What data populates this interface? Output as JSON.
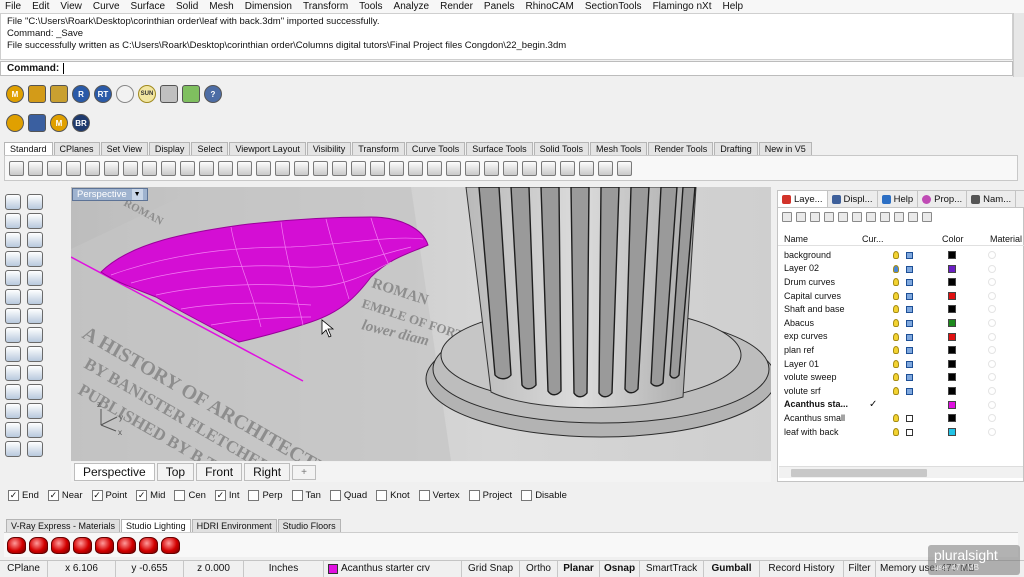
{
  "menu": [
    "File",
    "Edit",
    "View",
    "Curve",
    "Surface",
    "Solid",
    "Mesh",
    "Dimension",
    "Transform",
    "Tools",
    "Analyze",
    "Render",
    "Panels",
    "RhinoCAM",
    "SectionTools",
    "Flamingo nXt",
    "Help"
  ],
  "command_history": [
    "File \"C:\\Users\\Roark\\Desktop\\corinthian order\\leaf with back.3dm\" imported successfully.",
    "Command: _Save",
    "File successfully written as C:\\Users\\Roark\\Desktop\\corinthian order\\Columns digital tutors\\Final Project files Congdon\\22_begin.3dm"
  ],
  "command_prompt": "Command:",
  "plugin_row1": [
    "M",
    "",
    "",
    "R",
    "RT",
    "",
    "SUN",
    "",
    "",
    "?"
  ],
  "plugin_row2": [
    "",
    "",
    "M",
    "BR"
  ],
  "toolbar_tabs": [
    "Standard",
    "CPlanes",
    "Set View",
    "Display",
    "Select",
    "Viewport Layout",
    "Visibility",
    "Transform",
    "Curve Tools",
    "Surface Tools",
    "Solid Tools",
    "Mesh Tools",
    "Render Tools",
    "Drafting",
    "New in V5"
  ],
  "viewport": {
    "title": "Perspective",
    "tabs": [
      "Perspective",
      "Top",
      "Front",
      "Right"
    ],
    "add_tab": "+",
    "axis_x": "x",
    "axis_y": "y",
    "axis_z": "z",
    "engraving": {
      "line1": "A HISTORY OF ARCHITECTURE ON THE CO",
      "line2": "BY BANISTER FLETCHER, KNT. PRE",
      "line3": "PUBLISHED BY B.T. BATSFORD LT",
      "roman": "ROMAN",
      "roman2": "ROMAN",
      "fortuna": "EMPLE OF FORTUNA",
      "lower": "lower diam"
    }
  },
  "osnap": [
    {
      "label": "End",
      "checked": true
    },
    {
      "label": "Near",
      "checked": true
    },
    {
      "label": "Point",
      "checked": true
    },
    {
      "label": "Mid",
      "checked": true
    },
    {
      "label": "Cen",
      "checked": false
    },
    {
      "label": "Int",
      "checked": true
    },
    {
      "label": "Perp",
      "checked": false
    },
    {
      "label": "Tan",
      "checked": false
    },
    {
      "label": "Quad",
      "checked": false
    },
    {
      "label": "Knot",
      "checked": false
    },
    {
      "label": "Vertex",
      "checked": false
    },
    {
      "label": "Project",
      "checked": false
    },
    {
      "label": "Disable",
      "checked": false
    }
  ],
  "render_tabs": [
    "V-Ray Express - Materials",
    "Studio Lighting",
    "HDRI Environment",
    "Studio Floors"
  ],
  "status": {
    "cplane": "CPlane",
    "x": "x 6.106",
    "y": "y -0.655",
    "z": "z 0.000",
    "units": "Inches",
    "layer": "Acanthus starter crv",
    "grid_snap": "Grid Snap",
    "ortho": "Ortho",
    "planar": "Planar",
    "osnap": "Osnap",
    "smarttrack": "SmartTrack",
    "gumball": "Gumball",
    "record_history": "Record History",
    "filter": "Filter",
    "memory": "Memory use: 477 MB"
  },
  "panel": {
    "tabs": [
      "Laye...",
      "Displ...",
      "Help",
      "Prop...",
      "Nam..."
    ],
    "columns": {
      "name": "Name",
      "current": "Cur...",
      "color": "Color",
      "material": "Material"
    },
    "layers": [
      {
        "name": "background",
        "current": "",
        "color": "#000000",
        "bold": false
      },
      {
        "name": "Layer 02",
        "current": "",
        "color": "#6a1fc4",
        "bold": false
      },
      {
        "name": "Drum curves",
        "current": "",
        "color": "#000000",
        "bold": false
      },
      {
        "name": "Capital curves",
        "current": "",
        "color": "#e01010",
        "bold": false
      },
      {
        "name": "Shaft and base",
        "current": "",
        "color": "#000000",
        "bold": false
      },
      {
        "name": "Abacus",
        "current": "",
        "color": "#1c8a1c",
        "bold": false
      },
      {
        "name": "exp curves",
        "current": "",
        "color": "#e01010",
        "bold": false
      },
      {
        "name": "plan ref",
        "current": "",
        "color": "#000000",
        "bold": false
      },
      {
        "name": "Layer 01",
        "current": "",
        "color": "#000000",
        "bold": false
      },
      {
        "name": "volute sweep",
        "current": "",
        "color": "#000000",
        "bold": false
      },
      {
        "name": "volute srf",
        "current": "",
        "color": "#000000",
        "bold": false
      },
      {
        "name": "Acanthus sta...",
        "current": "✓",
        "color": "#e010e0",
        "bold": true
      },
      {
        "name": "Acanthus small",
        "current": "",
        "color": "#000000",
        "bold": false
      },
      {
        "name": "leaf with back",
        "current": "",
        "color": "#22c3e6",
        "bold": false
      }
    ]
  },
  "watermark": {
    "brand": "pluralsight",
    "sub": "use: 477 MB"
  },
  "colors": {
    "accent": "#e010e0",
    "viewport_title": "#9fb3cf"
  }
}
